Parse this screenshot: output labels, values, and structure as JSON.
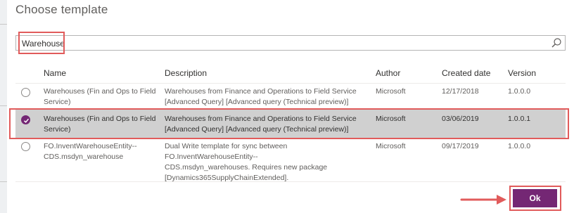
{
  "dialog": {
    "title": "Choose template"
  },
  "search": {
    "value": "Warehouse",
    "icon": "search-icon"
  },
  "table": {
    "columns": [
      "Name",
      "Description",
      "Author",
      "Created date",
      "Version"
    ],
    "rows": [
      {
        "selected": false,
        "name": [
          "Warehouses (Fin and Ops to Field",
          "Service)"
        ],
        "description": [
          "Warehouses from Finance and Operations to Field Service",
          "[Advanced Query] [Advanced query (Technical preview)]"
        ],
        "author": "Microsoft",
        "created": "12/17/2018",
        "version": "1.0.0.0"
      },
      {
        "selected": true,
        "name": [
          "Warehouses (Fin and Ops to Field",
          "Service)"
        ],
        "description": [
          "Warehouses from Finance and Operations to Field Service",
          "[Advanced Query] [Advanced query (Technical preview)]"
        ],
        "author": "Microsoft",
        "created": "03/06/2019",
        "version": "1.0.0.1"
      },
      {
        "selected": false,
        "name": [
          "FO.InventWarehouseEntity--",
          "CDS.msdyn_warehouse"
        ],
        "description": [
          "Dual Write template for sync between FO.InventWarehouseEntity--",
          "CDS.msdyn_warehouses. Requires new package",
          "[Dynamics365SupplyChainExtended]."
        ],
        "author": "Microsoft",
        "created": "09/17/2019",
        "version": "1.0.0.0"
      }
    ]
  },
  "actions": {
    "ok_label": "Ok"
  },
  "colors": {
    "accent": "#742774",
    "annotation": "#e15b5b",
    "selected_row": "#d0d0d0"
  }
}
